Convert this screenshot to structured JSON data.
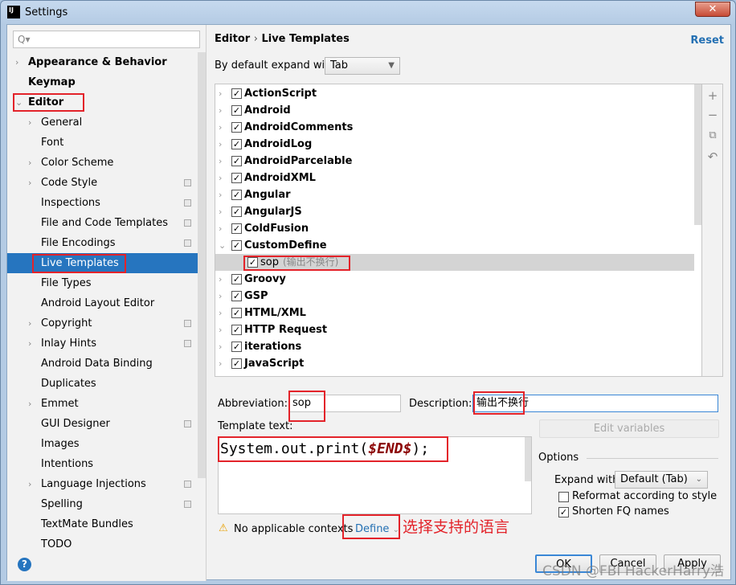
{
  "window": {
    "title": "Settings",
    "app_icon": "IJ",
    "close": "✕"
  },
  "sidebar": {
    "search_placeholder": "Q▾",
    "items": [
      {
        "label": "Appearance & Behavior",
        "level": 0,
        "bold": true,
        "arrow": "›"
      },
      {
        "label": "Keymap",
        "level": 0,
        "bold": true,
        "arrow": ""
      },
      {
        "label": "Editor",
        "level": 0,
        "bold": true,
        "arrow": "⌄"
      },
      {
        "label": "General",
        "level": 1,
        "arrow": "›"
      },
      {
        "label": "Font",
        "level": 1,
        "arrow": ""
      },
      {
        "label": "Color Scheme",
        "level": 1,
        "arrow": "›"
      },
      {
        "label": "Code Style",
        "level": 1,
        "arrow": "›",
        "project": true
      },
      {
        "label": "Inspections",
        "level": 1,
        "arrow": "",
        "project": true
      },
      {
        "label": "File and Code Templates",
        "level": 1,
        "arrow": "",
        "project": true
      },
      {
        "label": "File Encodings",
        "level": 1,
        "arrow": "",
        "project": true
      },
      {
        "label": "Live Templates",
        "level": 1,
        "arrow": "",
        "selected": true
      },
      {
        "label": "File Types",
        "level": 1,
        "arrow": ""
      },
      {
        "label": "Android Layout Editor",
        "level": 1,
        "arrow": ""
      },
      {
        "label": "Copyright",
        "level": 1,
        "arrow": "›",
        "project": true
      },
      {
        "label": "Inlay Hints",
        "level": 1,
        "arrow": "›",
        "project": true
      },
      {
        "label": "Android Data Binding",
        "level": 1,
        "arrow": ""
      },
      {
        "label": "Duplicates",
        "level": 1,
        "arrow": ""
      },
      {
        "label": "Emmet",
        "level": 1,
        "arrow": "›"
      },
      {
        "label": "GUI Designer",
        "level": 1,
        "arrow": "",
        "project": true
      },
      {
        "label": "Images",
        "level": 1,
        "arrow": ""
      },
      {
        "label": "Intentions",
        "level": 1,
        "arrow": ""
      },
      {
        "label": "Language Injections",
        "level": 1,
        "arrow": "›",
        "project": true
      },
      {
        "label": "Spelling",
        "level": 1,
        "arrow": "",
        "project": true
      },
      {
        "label": "TextMate Bundles",
        "level": 1,
        "arrow": ""
      },
      {
        "label": "TODO",
        "level": 1,
        "arrow": ""
      }
    ]
  },
  "main": {
    "breadcrumb": {
      "parent": "Editor",
      "sep": "›",
      "current": "Live Templates"
    },
    "reset": "Reset",
    "expand_label": "By default expand with",
    "expand_value": "Tab",
    "tree": [
      {
        "label": "ActionScript",
        "arrow": "›",
        "checked": true
      },
      {
        "label": "Android",
        "arrow": "›",
        "checked": true
      },
      {
        "label": "AndroidComments",
        "arrow": "›",
        "checked": true
      },
      {
        "label": "AndroidLog",
        "arrow": "›",
        "checked": true
      },
      {
        "label": "AndroidParcelable",
        "arrow": "›",
        "checked": true
      },
      {
        "label": "AndroidXML",
        "arrow": "›",
        "checked": true
      },
      {
        "label": "Angular",
        "arrow": "›",
        "checked": true
      },
      {
        "label": "AngularJS",
        "arrow": "›",
        "checked": true
      },
      {
        "label": "ColdFusion",
        "arrow": "›",
        "checked": true
      },
      {
        "label": "CustomDefine",
        "arrow": "⌄",
        "checked": true
      },
      {
        "label": "sop",
        "desc": "(输出不换行)",
        "child": true,
        "checked": true,
        "selected": true
      },
      {
        "label": "Groovy",
        "arrow": "›",
        "checked": true
      },
      {
        "label": "GSP",
        "arrow": "›",
        "checked": true
      },
      {
        "label": "HTML/XML",
        "arrow": "›",
        "checked": true
      },
      {
        "label": "HTTP Request",
        "arrow": "›",
        "checked": true
      },
      {
        "label": "iterations",
        "arrow": "›",
        "checked": true
      },
      {
        "label": "JavaScript",
        "arrow": "›",
        "checked": true
      }
    ],
    "toolbar": {
      "add": "+",
      "remove": "−",
      "copy": "⧉",
      "undo": "↶"
    },
    "abbreviation_label": "Abbreviation:",
    "abbreviation": "sop",
    "description_label": "Description:",
    "description": "输出不换行",
    "template_text_label": "Template text:",
    "template_code": "System.out.print(",
    "template_var": "$END$",
    "template_end": ");",
    "edit_variables": "Edit variables",
    "options_label": "Options",
    "expand_with_label": "Expand with",
    "expand_with_value": "Default (Tab)",
    "reformat_label": "Reformat according to style",
    "reformat_checked": false,
    "shorten_label": "Shorten FQ names",
    "shorten_checked": true,
    "warning_icon": "⚠",
    "no_contexts": "No applicable contexts",
    "define": "Define",
    "annotation": "选择支持的语言"
  },
  "buttons": {
    "ok": "OK",
    "cancel": "Cancel",
    "apply": "Apply",
    "help": "?"
  },
  "watermark": "CSDN @FBI HackerHarry浩",
  "colors": {
    "selection": "#2675bf",
    "highlight_box": "#e3232a",
    "link": "#2470b3"
  }
}
